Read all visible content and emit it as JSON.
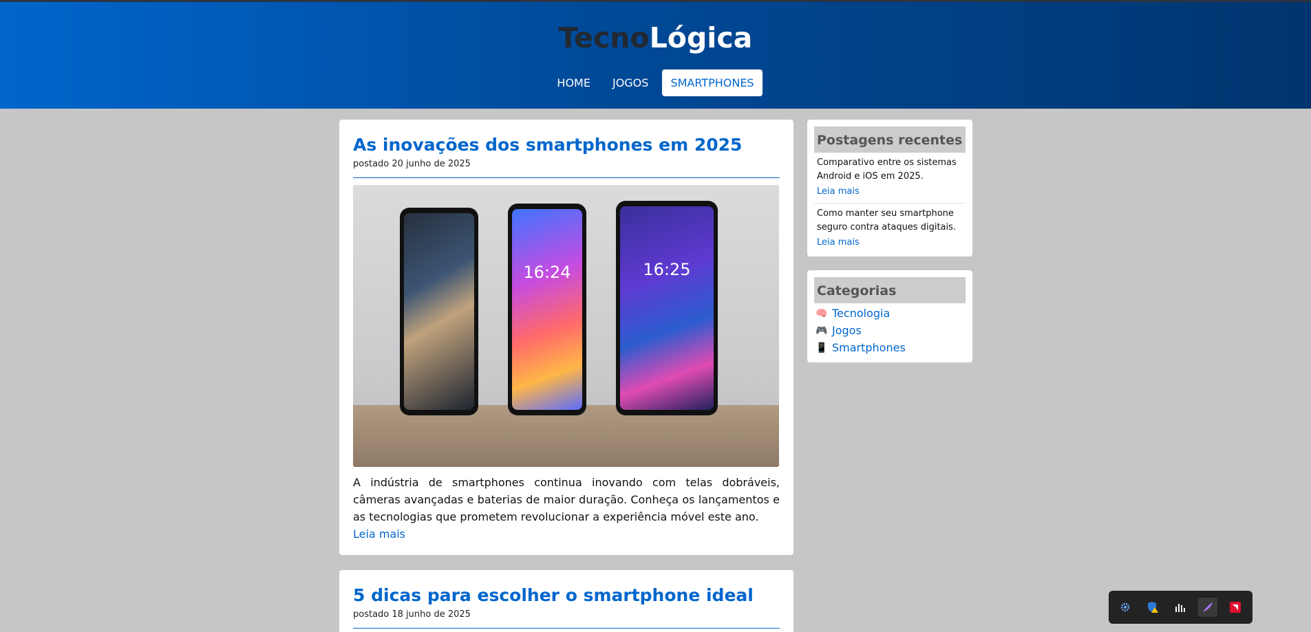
{
  "site": {
    "logo_part1": "Tecno",
    "logo_part2": "Lógica"
  },
  "nav": {
    "items": [
      {
        "label": "HOME",
        "active": false
      },
      {
        "label": "JOGOS",
        "active": false
      },
      {
        "label": "SMARTPHONES",
        "active": true
      }
    ]
  },
  "posts": [
    {
      "title": "As inovações dos smartphones em 2025",
      "date": "postado 20 junho de 2025",
      "image_clock_1": "16:24",
      "image_clock_2": "16:25",
      "excerpt": "A indústria de smartphones continua inovando com telas dobráveis, câmeras avançadas e baterias de maior duração. Conheça os lançamentos e as tecnologias que prometem revolucionar a experiência móvel este ano.",
      "more": "Leia mais"
    },
    {
      "title": "5 dicas para escolher o smartphone ideal",
      "date": "postado 18 junho de 2025"
    }
  ],
  "sidebar": {
    "recent": {
      "title": "Postagens recentes",
      "items": [
        {
          "text": "Comparativo entre os sistemas Android e iOS em 2025.",
          "more": "Leia mais"
        },
        {
          "text": "Como manter seu smartphone seguro contra ataques digitais.",
          "more": "Leia mais"
        }
      ]
    },
    "categories": {
      "title": "Categorias",
      "items": [
        {
          "label": "Tecnologia",
          "icon": "brain-icon"
        },
        {
          "label": "Jogos",
          "icon": "gamepad-icon"
        },
        {
          "label": "Smartphones",
          "icon": "phone-icon"
        }
      ]
    }
  },
  "tray": {
    "icons": [
      "settings-gear-icon",
      "defender-warning-icon",
      "audio-meter-icon",
      "feather-pen-icon",
      "amd-icon"
    ]
  },
  "colors": {
    "accent": "#0066cc",
    "header_start": "#0066cc",
    "header_end": "#00356f",
    "page_bg": "#c6c6c6"
  }
}
